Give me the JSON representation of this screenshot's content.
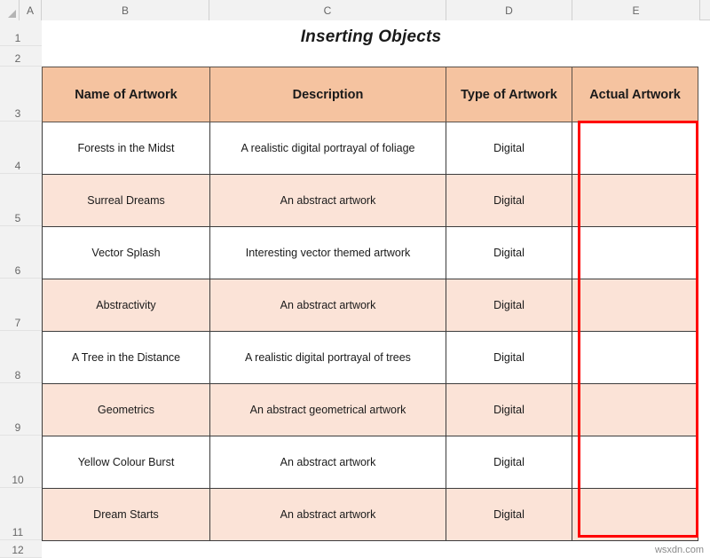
{
  "sheet": {
    "title": "Inserting Objects",
    "column_headers": [
      "A",
      "B",
      "C",
      "D",
      "E"
    ],
    "row_headers": [
      "1",
      "2",
      "3",
      "4",
      "5",
      "6",
      "7",
      "8",
      "9",
      "10",
      "11",
      "12"
    ],
    "corner_icon": "select-all-triangle-icon"
  },
  "table": {
    "headers": [
      "Name of Artwork",
      "Description",
      "Type of Artwork",
      "Actual Artwork"
    ],
    "rows": [
      {
        "name": "Forests in the Midst",
        "description": "A realistic digital portrayal of  foliage",
        "type": "Digital",
        "artwork": ""
      },
      {
        "name": "Surreal Dreams",
        "description": "An abstract artwork",
        "type": "Digital",
        "artwork": ""
      },
      {
        "name": "Vector Splash",
        "description": "Interesting vector themed artwork",
        "type": "Digital",
        "artwork": ""
      },
      {
        "name": "Abstractivity",
        "description": "An abstract artwork",
        "type": "Digital",
        "artwork": ""
      },
      {
        "name": "A Tree in the Distance",
        "description": "A realistic digital portrayal of trees",
        "type": "Digital",
        "artwork": ""
      },
      {
        "name": "Geometrics",
        "description": "An abstract geometrical artwork",
        "type": "Digital",
        "artwork": ""
      },
      {
        "name": "Yellow Colour Burst",
        "description": "An abstract artwork",
        "type": "Digital",
        "artwork": ""
      },
      {
        "name": "Dream Starts",
        "description": "An abstract artwork",
        "type": "Digital",
        "artwork": ""
      }
    ]
  },
  "selection": {
    "range_label": "E4:E11",
    "outline_color": "#ff0000"
  },
  "watermark": {
    "text": "wsxdn.com"
  },
  "colors": {
    "header_fill": "#f5c3a0",
    "band_tint_fill": "#fbe3d7",
    "band_light_fill": "#ffffff",
    "grid_header_bg": "#f2f2f2",
    "border": "#3c3c3c"
  }
}
